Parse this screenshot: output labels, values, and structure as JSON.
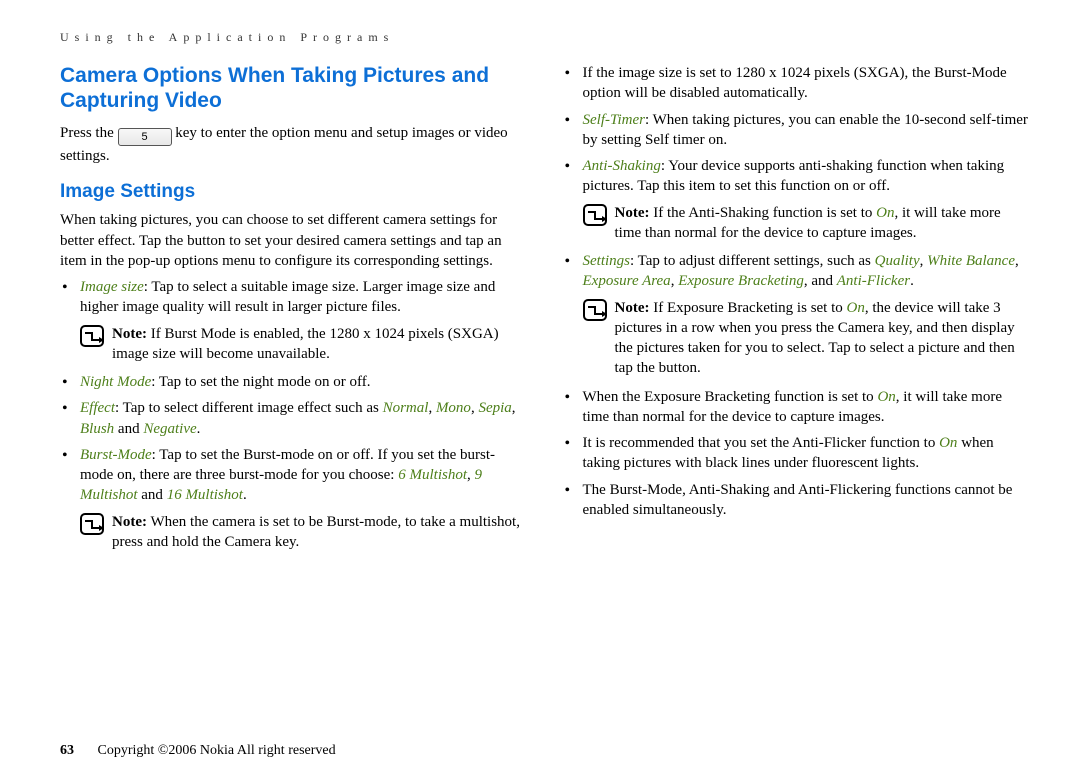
{
  "header": "Using the Application Programs",
  "h1": "Camera Options When Taking Pictures and Capturing Video",
  "press_a": "Press the ",
  "key_label": "5",
  "press_b": " key to enter the option menu and setup images or video settings.",
  "h2": "Image Settings",
  "intro_a": "When taking pictures, you can choose to set different camera settings for better effect. Tap the ",
  "intro_b": " button to set your desired camera settings and tap an item in the pop-up options menu to configure its corresponding settings.",
  "li_image_size_label": "Image size",
  "li_image_size_text": ": Tap to select a suitable image size. Larger image size and higher image quality will result in larger picture files.",
  "note1_label": "Note:",
  "note1_text": " If Burst Mode is enabled, the 1280 x 1024 pixels (SXGA) image size will become unavailable.",
  "li_night_label": "Night Mode",
  "li_night_text": ": Tap to set the night mode on or off.",
  "li_effect_label": "Effect",
  "li_effect_a": ": Tap to select different image effect such as ",
  "li_effect_normal": "Normal",
  "li_effect_mono": "Mono",
  "li_effect_sepia": "Sepia",
  "li_effect_blush": "Blush",
  "li_effect_and": " and ",
  "li_effect_negative": "Negative",
  "li_burst_label": "Burst-Mode",
  "li_burst_a": ": Tap to set the Burst-mode on or off. If you set the burst-mode on, there are three burst-mode for you choose: ",
  "li_burst_6": "6 Multishot",
  "li_burst_9": "9 Multishot",
  "li_burst_16": "16 Multishot",
  "note2_label": "Note:",
  "note2_text": " When the camera is set to be Burst-mode, to take a multishot, press and hold the Camera key.",
  "li_sxga": "If the image size is set to 1280 x 1024 pixels (SXGA), the Burst-Mode option will be disabled automatically.",
  "li_selftimer_label": "Self-Timer",
  "li_selftimer_text": ": When taking pictures, you can enable the 10-second self-timer by setting Self timer on.",
  "li_antishake_label": "Anti-Shaking",
  "li_antishake_text": ": Your device supports anti-shaking function when taking pictures. Tap this item to set this function on or off.",
  "note3_label": "Note:",
  "note3_a": " If the Anti-Shaking function is set to ",
  "note3_on": "On",
  "note3_b": ", it will take more time than normal for the device to capture images.",
  "li_settings_label": "Settings",
  "li_settings_a": ": Tap to adjust different settings, such as ",
  "li_settings_quality": "Quality",
  "li_settings_wb": "White Balance",
  "li_settings_ea": "Exposure Area",
  "li_settings_eb": "Exposure Bracketing",
  "li_settings_and": ", and ",
  "li_settings_af": "Anti-Flicker",
  "note4_label": "Note:",
  "note4_a": " If Exposure Bracketing is set to ",
  "note4_on": "On",
  "note4_b": ", the device will take 3 pictures in a row when you press the Camera key, and then display the pictures taken for you to select. Tap to select a picture and then tap the ",
  "note4_c": " button.",
  "li_exposure_a": "When the Exposure Bracketing function is set to ",
  "li_exposure_on": "On",
  "li_exposure_b": ", it will take more time than normal for the device to capture images.",
  "li_antiflicker_a": "It is recommended that you set the Anti-Flicker function to ",
  "li_antiflicker_on": "On",
  "li_antiflicker_b": " when taking pictures with black lines under fluorescent lights.",
  "li_simul": "The Burst-Mode, Anti-Shaking and Anti-Flickering functions cannot be enabled simultaneously.",
  "page_num": "63",
  "copyright": "Copyright ©2006 Nokia All right reserved",
  "comma": ", ",
  "period": "."
}
